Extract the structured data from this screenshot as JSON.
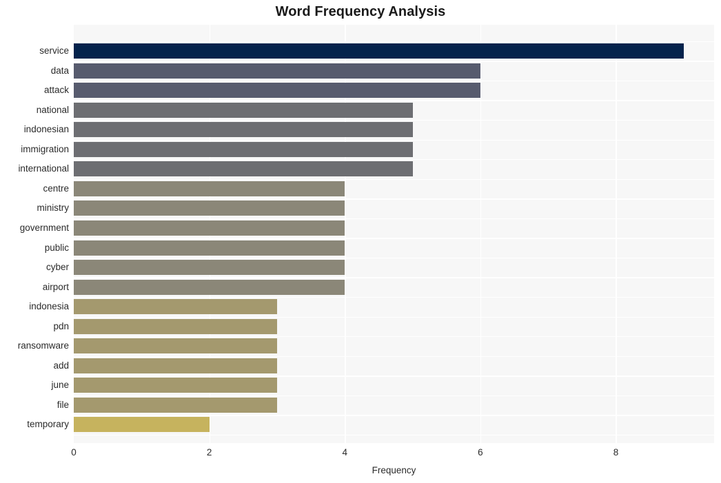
{
  "chart_data": {
    "type": "bar",
    "orientation": "horizontal",
    "title": "Word Frequency Analysis",
    "xlabel": "Frequency",
    "ylabel": "",
    "xlim": [
      0,
      9.45
    ],
    "xticks": [
      0,
      2,
      4,
      6,
      8
    ],
    "xtick_labels": [
      "0",
      "2",
      "4",
      "6",
      "8"
    ],
    "grid": true,
    "legend": "none",
    "categories": [
      "service",
      "data",
      "attack",
      "national",
      "indonesian",
      "immigration",
      "international",
      "centre",
      "ministry",
      "government",
      "public",
      "cyber",
      "airport",
      "indonesia",
      "pdn",
      "ransomware",
      "add",
      "june",
      "file",
      "temporary"
    ],
    "values": [
      9,
      6,
      6,
      5,
      5,
      5,
      5,
      4,
      4,
      4,
      4,
      4,
      4,
      3,
      3,
      3,
      3,
      3,
      3,
      2
    ],
    "bar_colors": [
      "#04234c",
      "#575b6e",
      "#575b6e",
      "#6d6e72",
      "#6d6e72",
      "#6d6e72",
      "#6d6e72",
      "#8b8778",
      "#8b8778",
      "#8b8778",
      "#8b8778",
      "#8b8778",
      "#8b8778",
      "#a4996e",
      "#a4996e",
      "#a4996e",
      "#a4996e",
      "#a4996e",
      "#a4996e",
      "#c6b35e"
    ]
  },
  "colors": {
    "plot_background": "#f7f7f7",
    "gridline": "#ffffff",
    "figure_background": "#ffffff",
    "text": "#2b2b2b",
    "title": "#1a1a1a"
  }
}
